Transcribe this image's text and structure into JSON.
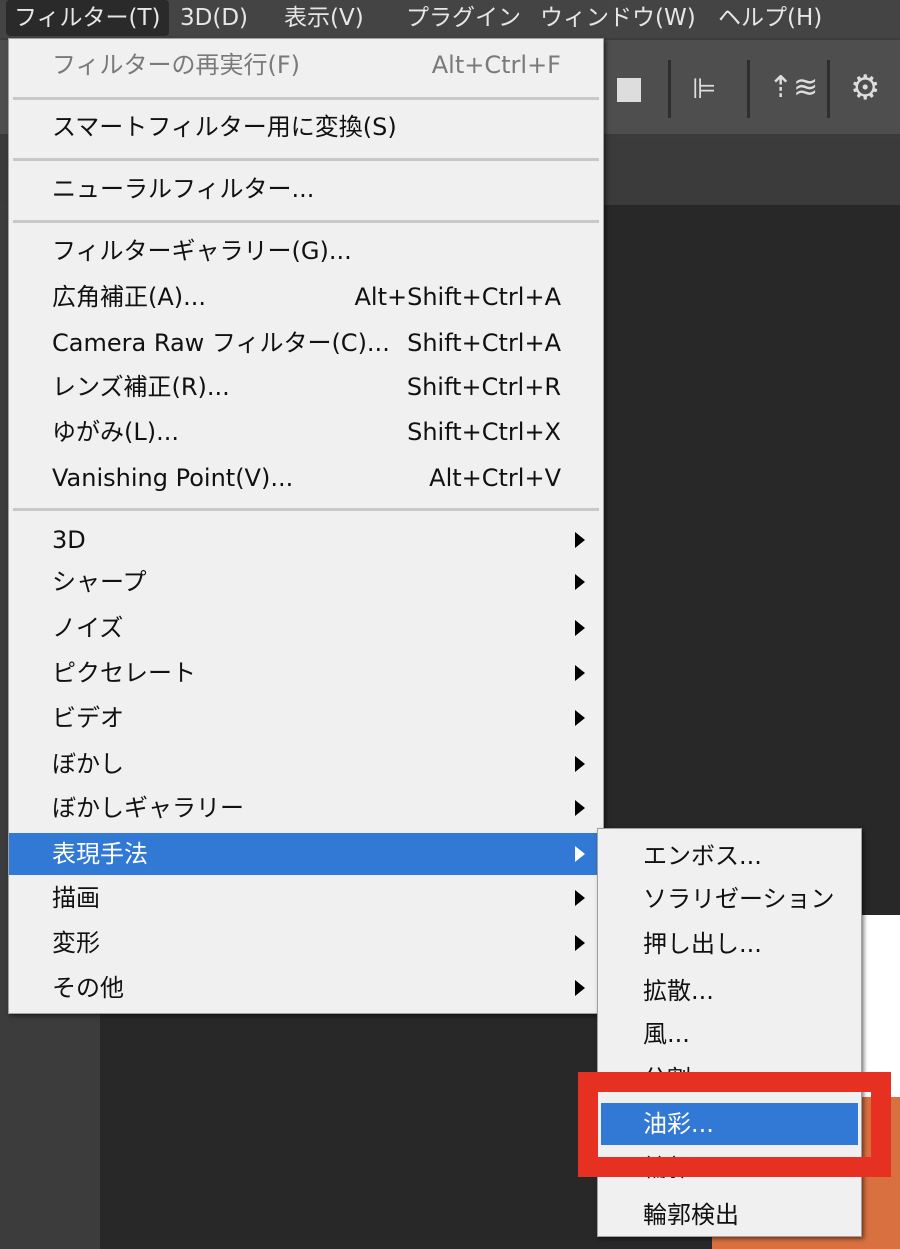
{
  "menubar": {
    "items": [
      "フィルター(T)",
      "3D(D)",
      "表示(V)",
      "プラグイン",
      "ウィンドウ(W)",
      "ヘルプ(H)"
    ]
  },
  "toolbar": {
    "icons": [
      "square-icon",
      "align-left-icon",
      "layers-icon",
      "gear-icon"
    ]
  },
  "filter_menu": {
    "items": [
      {
        "label": "フィルターの再実行(F)",
        "shortcut": "Alt+Ctrl+F",
        "disabled": true
      },
      {
        "label": "スマートフィルター用に変換(S)"
      },
      {
        "label": "ニューラルフィルター..."
      },
      {
        "label": "フィルターギャラリー(G)..."
      },
      {
        "label": "広角補正(A)...",
        "shortcut": "Alt+Shift+Ctrl+A"
      },
      {
        "label": "Camera Raw フィルター(C)...",
        "shortcut": "Shift+Ctrl+A"
      },
      {
        "label": "レンズ補正(R)...",
        "shortcut": "Shift+Ctrl+R"
      },
      {
        "label": "ゆがみ(L)...",
        "shortcut": "Shift+Ctrl+X"
      },
      {
        "label": "Vanishing Point(V)...",
        "shortcut": "Alt+Ctrl+V"
      },
      {
        "label": "3D"
      },
      {
        "label": "シャープ"
      },
      {
        "label": "ノイズ"
      },
      {
        "label": "ピクセレート"
      },
      {
        "label": "ビデオ"
      },
      {
        "label": "ぼかし"
      },
      {
        "label": "ぼかしギャラリー"
      },
      {
        "label": "表現手法",
        "highlighted": true
      },
      {
        "label": "描画"
      },
      {
        "label": "変形"
      },
      {
        "label": "その他"
      }
    ]
  },
  "stylize_submenu": {
    "items": [
      "エンボス...",
      "ソラリゼーション",
      "押し出し...",
      "拡散...",
      "風...",
      "分割...",
      "油彩...",
      "輪郭のトレース...",
      "輪郭検出"
    ],
    "highlighted": "油彩..."
  },
  "colors": {
    "highlight": "#3179d4",
    "annotation": "#e53022"
  }
}
